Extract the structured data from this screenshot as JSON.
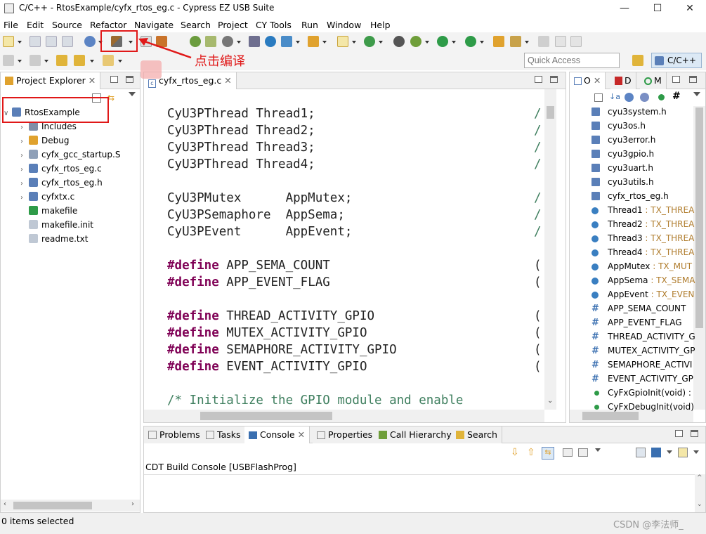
{
  "window": {
    "title": "C/C++ - RtosExample/cyfx_rtos_eg.c - Cypress EZ USB Suite",
    "minimize": "—",
    "maximize": "☐",
    "close": "✕"
  },
  "menu": [
    "File",
    "Edit",
    "Source",
    "Refactor",
    "Navigate",
    "Search",
    "Project",
    "CY Tools",
    "Run",
    "Window",
    "Help"
  ],
  "toolbar": {
    "build_icon": "hammer-icon",
    "quick_access_placeholder": "Quick Access",
    "perspective_label": "C/C++"
  },
  "annotation": {
    "label": "点击编译",
    "color": "#e01818"
  },
  "project_explorer": {
    "tab_label": "Project Explorer",
    "project": "RtosExample",
    "items": [
      {
        "label": "Includes",
        "icon": "includes-icon",
        "expandable": true
      },
      {
        "label": "Debug",
        "icon": "folder-icon",
        "expandable": true
      },
      {
        "label": "cyfx_gcc_startup.S",
        "icon": "asm-file-icon",
        "expandable": true
      },
      {
        "label": "cyfx_rtos_eg.c",
        "icon": "c-file-icon",
        "expandable": true
      },
      {
        "label": "cyfx_rtos_eg.h",
        "icon": "h-file-icon",
        "expandable": true
      },
      {
        "label": "cyfxtx.c",
        "icon": "c-file-icon",
        "expandable": true
      },
      {
        "label": "makefile",
        "icon": "makefile-icon",
        "expandable": false
      },
      {
        "label": "makefile.init",
        "icon": "file-icon",
        "expandable": false
      },
      {
        "label": "readme.txt",
        "icon": "file-icon",
        "expandable": false
      }
    ]
  },
  "editor": {
    "tab_label": "cyfx_rtos_eg.c",
    "lines": [
      {
        "text": "CyU3PThread Thread1;",
        "tail": "/"
      },
      {
        "text": "CyU3PThread Thread2;",
        "tail": "/"
      },
      {
        "text": "CyU3PThread Thread3;",
        "tail": "/"
      },
      {
        "text": "CyU3PThread Thread4;",
        "tail": "/"
      },
      {
        "text": "CyU3PMutex      AppMutex;",
        "tail": "/"
      },
      {
        "text": "CyU3PSemaphore  AppSema;",
        "tail": "/"
      },
      {
        "text": "CyU3PEvent      AppEvent;",
        "tail": "/"
      },
      {
        "kw": "#define",
        "text": " APP_SEMA_COUNT",
        "tail": "("
      },
      {
        "kw": "#define",
        "text": " APP_EVENT_FLAG",
        "tail": "("
      },
      {
        "kw": "#define",
        "text": " THREAD_ACTIVITY_GPIO",
        "tail": "("
      },
      {
        "kw": "#define",
        "text": " MUTEX_ACTIVITY_GPIO",
        "tail": "("
      },
      {
        "kw": "#define",
        "text": " SEMAPHORE_ACTIVITY_GPIO",
        "tail": "("
      },
      {
        "kw": "#define",
        "text": " EVENT_ACTIVITY_GPIO",
        "tail": "("
      },
      {
        "comment": "/* Initialize the GPIO module and enable"
      }
    ]
  },
  "outline": {
    "tabs": [
      "O",
      "D",
      "M"
    ],
    "items": [
      {
        "label": "cyu3system.h",
        "type": "",
        "kind": "h"
      },
      {
        "label": "cyu3os.h",
        "type": "",
        "kind": "h"
      },
      {
        "label": "cyu3error.h",
        "type": "",
        "kind": "h"
      },
      {
        "label": "cyu3gpio.h",
        "type": "",
        "kind": "h"
      },
      {
        "label": "cyu3uart.h",
        "type": "",
        "kind": "h"
      },
      {
        "label": "cyu3utils.h",
        "type": "",
        "kind": "h"
      },
      {
        "label": "cyfx_rtos_eg.h",
        "type": "",
        "kind": "h"
      },
      {
        "label": "Thread1",
        "type": " : TX_THREA",
        "kind": "dot"
      },
      {
        "label": "Thread2",
        "type": " : TX_THREA",
        "kind": "dot"
      },
      {
        "label": "Thread3",
        "type": " : TX_THREA",
        "kind": "dot"
      },
      {
        "label": "Thread4",
        "type": " : TX_THREA",
        "kind": "dot"
      },
      {
        "label": "AppMutex",
        "type": " : TX_MUT",
        "kind": "dot"
      },
      {
        "label": "AppSema",
        "type": " : TX_SEMA",
        "kind": "dot"
      },
      {
        "label": "AppEvent",
        "type": " : TX_EVEN",
        "kind": "dot"
      },
      {
        "label": "APP_SEMA_COUNT",
        "type": "",
        "kind": "hash"
      },
      {
        "label": "APP_EVENT_FLAG",
        "type": "",
        "kind": "hash"
      },
      {
        "label": "THREAD_ACTIVITY_G",
        "type": "",
        "kind": "hash"
      },
      {
        "label": "MUTEX_ACTIVITY_GP",
        "type": "",
        "kind": "hash"
      },
      {
        "label": "SEMAPHORE_ACTIVI",
        "type": "",
        "kind": "hash"
      },
      {
        "label": "EVENT_ACTIVITY_GP",
        "type": "",
        "kind": "hash"
      },
      {
        "label": "CyFxGpioInit(void) : ",
        "type": "",
        "kind": "fn"
      },
      {
        "label": "CyFxDebugInit(void)",
        "type": "",
        "kind": "fn"
      }
    ]
  },
  "bottom": {
    "tabs": [
      "Problems",
      "Tasks",
      "Console",
      "Properties",
      "Call Hierarchy",
      "Search"
    ],
    "active_tab": "Console",
    "console_title": "CDT Build Console [USBFlashProg]"
  },
  "status": {
    "selection": "0 items selected",
    "watermark": "CSDN @李法师_"
  }
}
